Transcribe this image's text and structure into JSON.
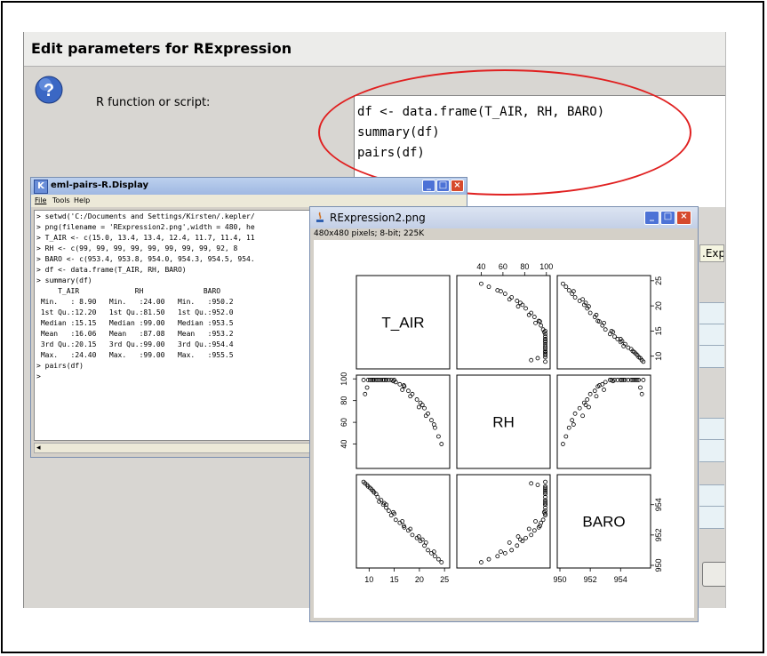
{
  "dialog": {
    "title": "Edit parameters for RExpression",
    "label": "R function or script:",
    "script_lines": [
      "df <- data.frame(T_AIR, RH, BARO)",
      "summary(df)",
      "pairs(df)"
    ],
    "side_strip_text": ".Expr"
  },
  "console": {
    "title": "eml-pairs-R.Display",
    "menu": [
      "File",
      "Tools",
      "Help"
    ],
    "lines": [
      "> setwd('C:/Documents and Settings/Kirsten/.kepler/",
      "> png(filename = 'RExpression2.png',width = 480, he",
      "> T_AIR <- c(15.0, 13.4, 13.4, 12.4, 11.7, 11.4, 11",
      "> RH <- c(99, 99, 99, 99, 99, 99, 99, 99, 92, 8",
      "> BARO <- c(953.4, 953.8, 954.0, 954.3, 954.5, 954.",
      "> df <- data.frame(T_AIR, RH, BARO)",
      "> summary(df)",
      "     T_AIR             RH              BARO",
      " Min.   : 8.90   Min.   :24.00   Min.   :950.2",
      " 1st Qu.:12.20   1st Qu.:81.50   1st Qu.:952.0",
      " Median :15.15   Median :99.00   Median :953.5",
      " Mean   :16.06   Mean   :87.08   Mean   :953.2",
      " 3rd Qu.:20.15   3rd Qu.:99.00   3rd Qu.:954.4",
      " Max.   :24.40   Max.   :99.00   Max.   :955.5",
      "> pairs(df)",
      ">"
    ]
  },
  "image_window": {
    "title": "RExpression2.png",
    "info": "480x480 pixels; 8-bit; 225K"
  },
  "chart_data": {
    "type": "scatter",
    "variables": [
      "T_AIR",
      "RH",
      "BARO"
    ],
    "T_AIR": [
      15.0,
      13.4,
      13.4,
      12.4,
      11.7,
      11.4,
      10.8,
      10.2,
      9.6,
      9.2,
      8.9,
      10.5,
      12.0,
      13.9,
      14.4,
      15.3,
      16.1,
      17.0,
      17.8,
      18.6,
      19.5,
      20.2,
      21.0,
      21.7,
      22.4,
      23.1,
      23.8,
      24.4,
      22.9,
      21.3,
      19.9,
      18.2,
      16.6,
      14.8,
      13.0,
      11.0,
      9.8,
      12.8,
      16.9,
      20.6
    ],
    "RH": [
      99,
      99,
      99,
      99,
      99,
      99,
      99,
      99,
      92,
      86,
      99,
      99,
      99,
      99,
      99,
      97,
      95,
      93,
      89,
      86,
      81,
      78,
      73,
      68,
      62,
      55,
      47,
      40,
      58,
      66,
      74,
      84,
      90,
      98,
      99,
      99,
      99,
      99,
      94,
      76
    ],
    "BARO": [
      953.4,
      953.8,
      954.0,
      954.3,
      954.5,
      954.7,
      954.9,
      955.1,
      955.3,
      955.4,
      955.5,
      955.0,
      954.2,
      953.6,
      953.3,
      953.0,
      952.8,
      952.5,
      952.3,
      952.0,
      951.8,
      951.6,
      951.3,
      951.0,
      950.8,
      950.6,
      950.4,
      950.2,
      950.9,
      951.5,
      951.9,
      952.4,
      952.9,
      953.5,
      954.1,
      954.8,
      955.2,
      954.0,
      952.6,
      951.7
    ],
    "axis_ticks": {
      "T_AIR": [
        10,
        15,
        20,
        25
      ],
      "RH": [
        40,
        60,
        80,
        100
      ],
      "BARO": [
        950,
        952,
        954
      ]
    },
    "ranges": {
      "T_AIR": [
        8,
        25.5
      ],
      "RH": [
        20,
        101
      ],
      "BARO": [
        950,
        955.8
      ]
    }
  }
}
